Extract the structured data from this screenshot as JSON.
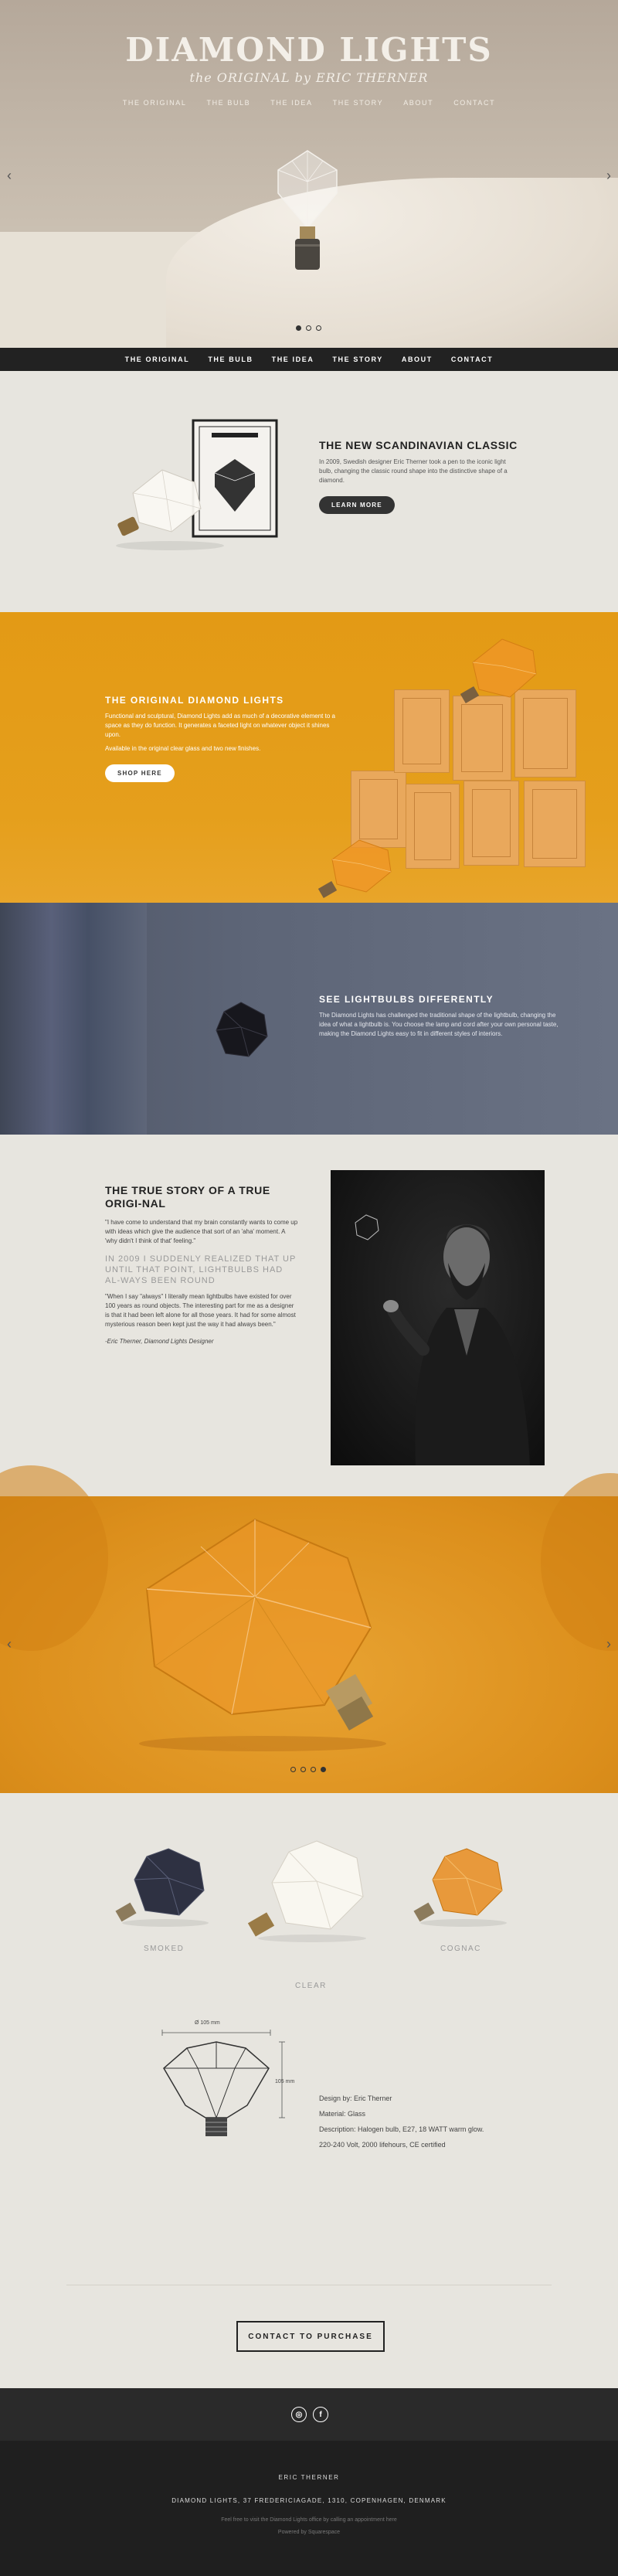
{
  "brand": {
    "title": "DIAMOND LIGHTS",
    "subtitle": "the ORIGINAL by ERIC THERNER"
  },
  "nav": [
    "THE ORIGINAL",
    "THE BULB",
    "THE IDEA",
    "THE STORY",
    "ABOUT",
    "CONTACT"
  ],
  "hero": {
    "slides": 3,
    "active_slide": 1
  },
  "classic": {
    "title": "THE NEW SCANDINAVIAN CLASSIC",
    "body": "In 2009, Swedish designer Eric Therner took a pen to the iconic light bulb, changing the classic round shape into the distinctive shape of a diamond.",
    "button": "LEARN MORE"
  },
  "original": {
    "title": "THE ORIGINAL DIAMOND LIGHTS",
    "body": "Functional and sculptural, Diamond Lights add as much of a decorative element to a space as they do function. It generates a faceted light on whatever object it shines upon.",
    "body2": "Available in the original clear glass and two new finishes.",
    "button": "SHOP HERE"
  },
  "see": {
    "title": "SEE LIGHTBULBS DIFFERENTLY",
    "body": "The Diamond Lights has challenged the traditional shape of the lightbulb, changing the idea of what a lightbulb is. You choose the lamp and cord after your own personal taste, making the Diamond Lights easy to fit in different styles of interiors."
  },
  "story": {
    "title": "THE TRUE STORY OF A TRUE ORIGI-NAL",
    "quote1": "\"I have come to understand that my brain constantly wants to come up with ideas which give the audience that sort of an 'aha' moment. A 'why didn't I think of that' feeling.\"",
    "highlight": "IN 2009 I SUDDENLY REALIZED THAT UP UNTIL THAT POINT, LIGHTBULBS HAD AL-WAYS BEEN ROUND",
    "quote2": "\"When I say \"always\" I literally mean lightbulbs have existed for over 100 years as round objects. The interesting part for me as a designer is that it had been left alone for all those years. It had for some almost mysterious reason been kept just the way it had always been.\"",
    "signature": "-Eric Therner, Diamond Lights Designer"
  },
  "big_slider": {
    "slides": 4,
    "active_slide": 4
  },
  "variants": {
    "left": "SMOKED",
    "center": "CLEAR",
    "right": "COGNAC"
  },
  "specs": {
    "dim_width": "Ø 105 mm",
    "dim_height": "105 mm",
    "lines": [
      "Design by: Eric Therner",
      "Material: Glass",
      "Description: Halogen bulb, E27, 18 WATT warm glow.",
      "220-240 Volt, 2000 lifehours, CE certified"
    ]
  },
  "cta": {
    "button": "CONTACT TO PURCHASE"
  },
  "social": {
    "instagram": "◎",
    "facebook": "f"
  },
  "footer": {
    "name": "ERIC THERNER",
    "address": "DIAMOND LIGHTS, 37 FREDERICIAGADE, 1310, COPENHAGEN, DENMARK",
    "note": "Feel free to visit the Diamond Lights office by calling an appointment here",
    "powered": "Powered by Squarespace"
  },
  "colors": {
    "orange": "#e39a15",
    "dark": "#222222",
    "cream": "#e7e5df",
    "slate": "#5d6577"
  }
}
